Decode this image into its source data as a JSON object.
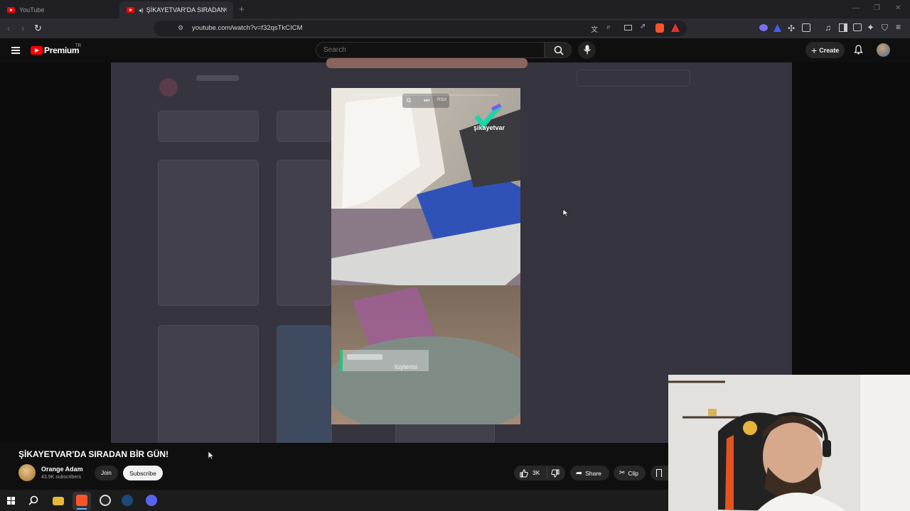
{
  "browser": {
    "tabs": [
      {
        "title": "YouTube",
        "active": false
      },
      {
        "title": "ŞİKAYETVAR'DA SIRADAN BİR",
        "active": true
      }
    ],
    "url": "youtube.com/watch?v=f32qsTkCICM",
    "colors": {
      "accent": "#ff0000"
    }
  },
  "youtube": {
    "brand": "Premium",
    "brand_sup": "TR",
    "search_placeholder": "Search",
    "create_label": "Create"
  },
  "video": {
    "watermark": "şikayetvar",
    "overlay_badge": "RSX",
    "toast_text": "lüşterisi"
  },
  "info": {
    "title": "ŞİKAYETVAR'DA SIRADAN BİR GÜN!",
    "channel_name": "Orange Adam",
    "subscribers": "43.9K subscribers",
    "join_label": "Join",
    "subscribe_label": "Subscribe",
    "like_count": "3K",
    "share_label": "Share",
    "clip_label": "Clip"
  },
  "taskbar": {
    "apps": [
      "windows-start-icon",
      "search-icon",
      "file-explorer-icon",
      "brave-icon",
      "chrome-icon",
      "steam-icon",
      "discord-icon"
    ]
  }
}
